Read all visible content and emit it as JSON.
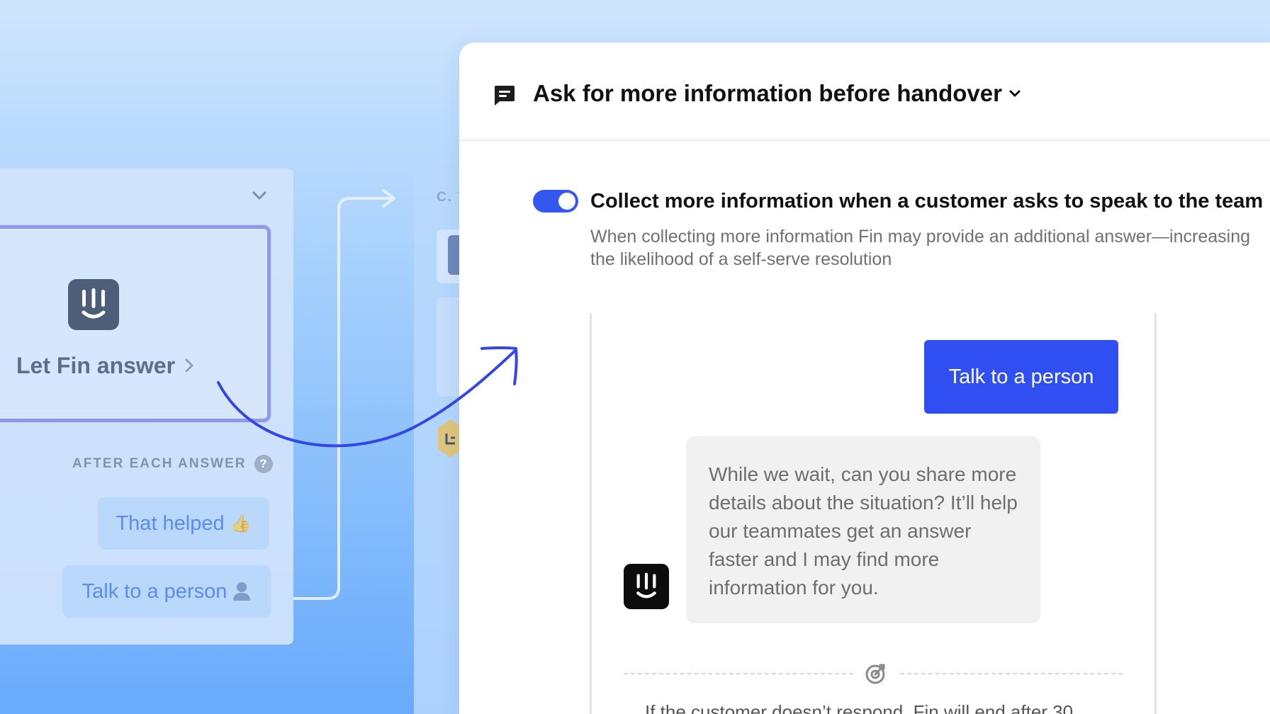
{
  "flow": {
    "step_label": "Let Fin answer",
    "after_label": "AFTER EACH ANSWER",
    "help_glyph": "?",
    "buttons": [
      {
        "label": "That helped",
        "emoji": "👍"
      },
      {
        "label": "Talk to a person",
        "icon": "person-icon"
      }
    ],
    "partial_label": "C. T"
  },
  "panel": {
    "title": "Ask for more information before handover",
    "setting": {
      "enabled": true,
      "title": "Collect more information when a customer asks to speak to the team",
      "description": "When collecting more information Fin may provide an additional answer—increasing the likelihood of a self-serve resolution"
    },
    "preview": {
      "user_message": "Talk to a person",
      "bot_message": "While we wait, can you share more details about the situation? It’ll help our teammates get an answer faster and I may find more information for you.",
      "footer_note": "If the customer doesn’t respond, Fin will end after 30"
    }
  },
  "colors": {
    "accent": "#3457f0",
    "user_bubble": "#2f4ff2",
    "arrow": "#3247e6",
    "fin_logo_dark": "#0c0c0c",
    "fin_logo_muted": "#4c5e78"
  }
}
